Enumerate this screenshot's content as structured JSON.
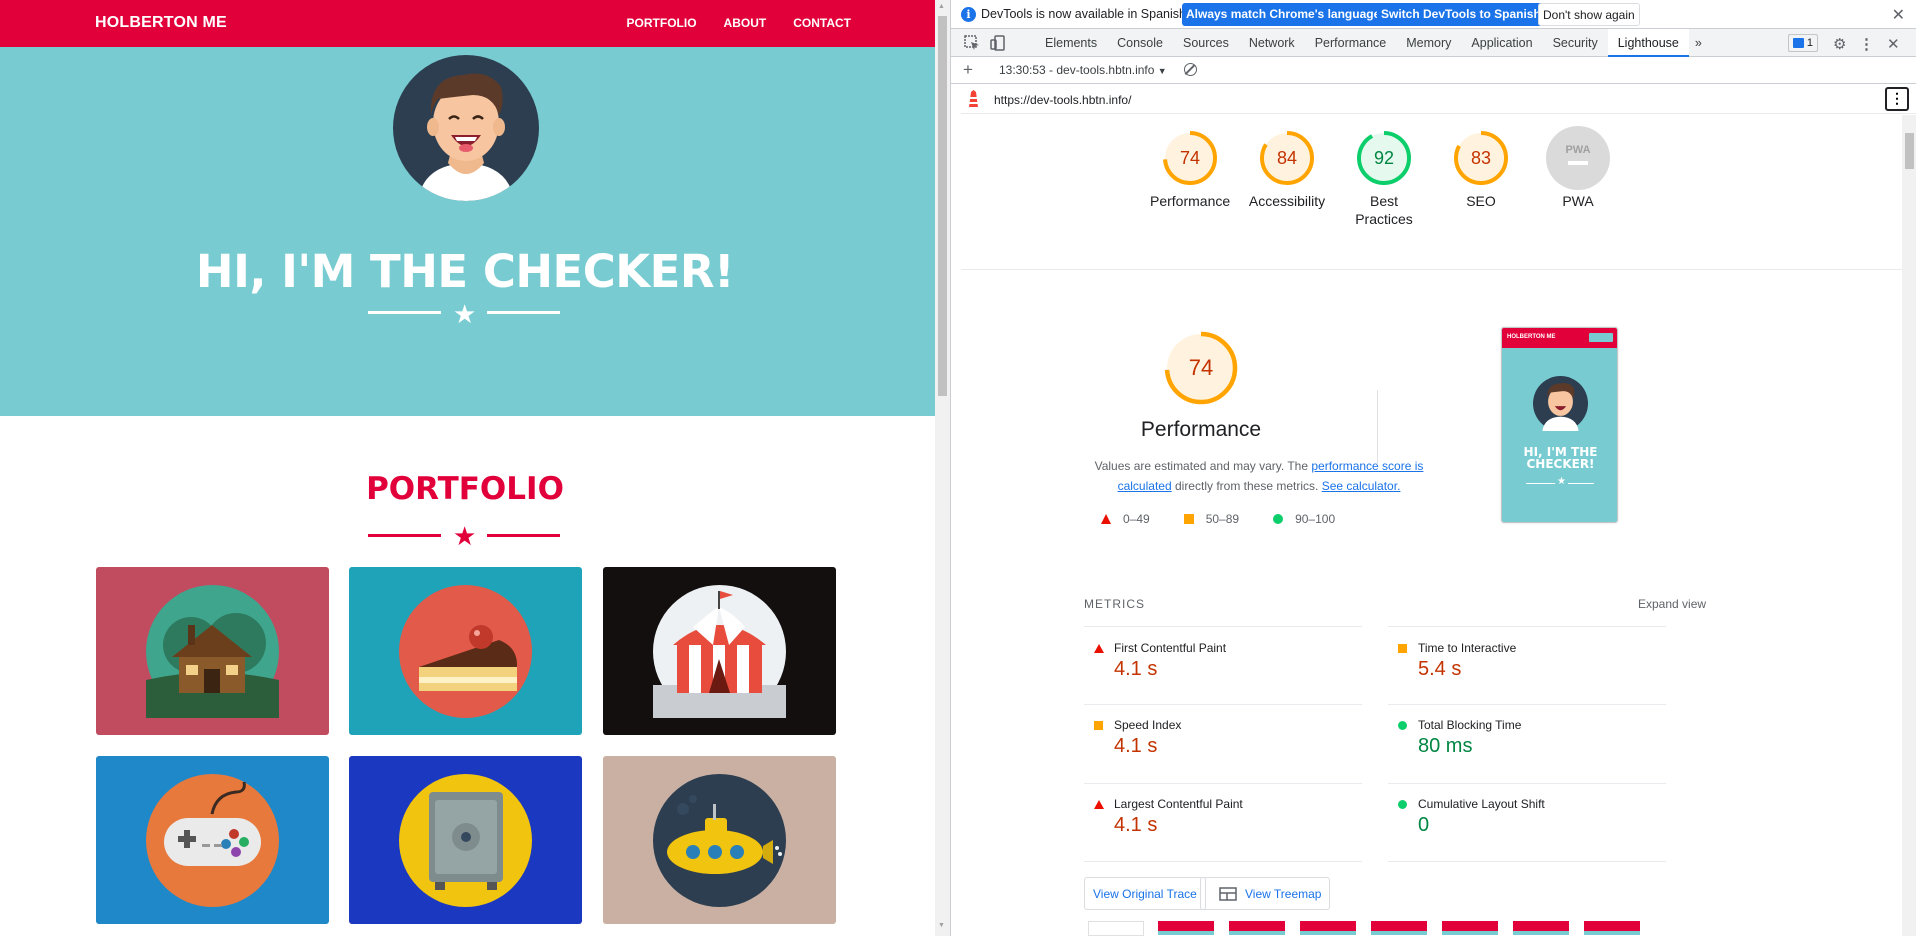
{
  "site": {
    "brand": "HOLBERTON ME",
    "nav": [
      "PORTFOLIO",
      "ABOUT",
      "CONTACT"
    ],
    "hero_title": "HI, I'M THE CHECKER!",
    "section_title": "PORTFOLIO",
    "portfolio_items": [
      {
        "icon": "cabin-icon",
        "bg": "#c14c60"
      },
      {
        "icon": "cake-icon",
        "bg": "#1ea3b8"
      },
      {
        "icon": "circus-tent-icon",
        "bg": "#130f0f"
      },
      {
        "icon": "game-controller-icon",
        "bg": "#1e88c9"
      },
      {
        "icon": "safe-icon",
        "bg": "#1b38c1"
      },
      {
        "icon": "submarine-icon",
        "bg": "#c9b0a2"
      }
    ],
    "colors": {
      "primary": "#e2003b",
      "hero": "#78ccd1"
    }
  },
  "devtools": {
    "infobar": {
      "message": "DevTools is now available in Spanish!",
      "btn_match": "Always match Chrome's language",
      "btn_switch": "Switch DevTools to Spanish",
      "btn_dismiss": "Don't show again"
    },
    "tabs": [
      "Elements",
      "Console",
      "Sources",
      "Network",
      "Performance",
      "Memory",
      "Application",
      "Security",
      "Lighthouse"
    ],
    "active_tab": "Lighthouse",
    "issues_count": "1",
    "report_select": "13:30:53 - dev-tools.hbtn.info",
    "url": "https://dev-tools.hbtn.info/",
    "scores": [
      {
        "label": "Performance",
        "score": "74",
        "value": 74,
        "rating": "average"
      },
      {
        "label": "Accessibility",
        "score": "84",
        "value": 84,
        "rating": "average"
      },
      {
        "label": "Best Practices",
        "score": "92",
        "value": 92,
        "rating": "pass"
      },
      {
        "label": "SEO",
        "score": "83",
        "value": 83,
        "rating": "average"
      },
      {
        "label": "PWA",
        "score": "PWA",
        "value": 0,
        "rating": "na"
      }
    ],
    "performance": {
      "score": "74",
      "title": "Performance",
      "desc_prefix": "Values are estimated and may vary. The ",
      "desc_link1": "performance score is calculated",
      "desc_mid": " directly from these metrics. ",
      "desc_link2": "See calculator.",
      "legend": [
        "0–49",
        "50–89",
        "90–100"
      ]
    },
    "preview": {
      "brand": "HOLBERTON ME",
      "title": "HI, I'M THE CHECKER!"
    },
    "metrics_heading": "METRICS",
    "expand_view": "Expand view",
    "metrics": [
      {
        "name": "First Contentful Paint",
        "value": "4.1 s",
        "rating": "fail"
      },
      {
        "name": "Time to Interactive",
        "value": "5.4 s",
        "rating": "average"
      },
      {
        "name": "Speed Index",
        "value": "4.1 s",
        "rating": "average"
      },
      {
        "name": "Total Blocking Time",
        "value": "80 ms",
        "rating": "pass"
      },
      {
        "name": "Largest Contentful Paint",
        "value": "4.1 s",
        "rating": "fail"
      },
      {
        "name": "Cumulative Layout Shift",
        "value": "0",
        "rating": "pass"
      }
    ],
    "btn_trace": "View Original Trace",
    "btn_treemap": "View Treemap",
    "colors": {
      "fail": "#eb0f00",
      "average": "#ffa400",
      "pass": "#0cce6b",
      "active_tab": "#1a73e8"
    }
  }
}
